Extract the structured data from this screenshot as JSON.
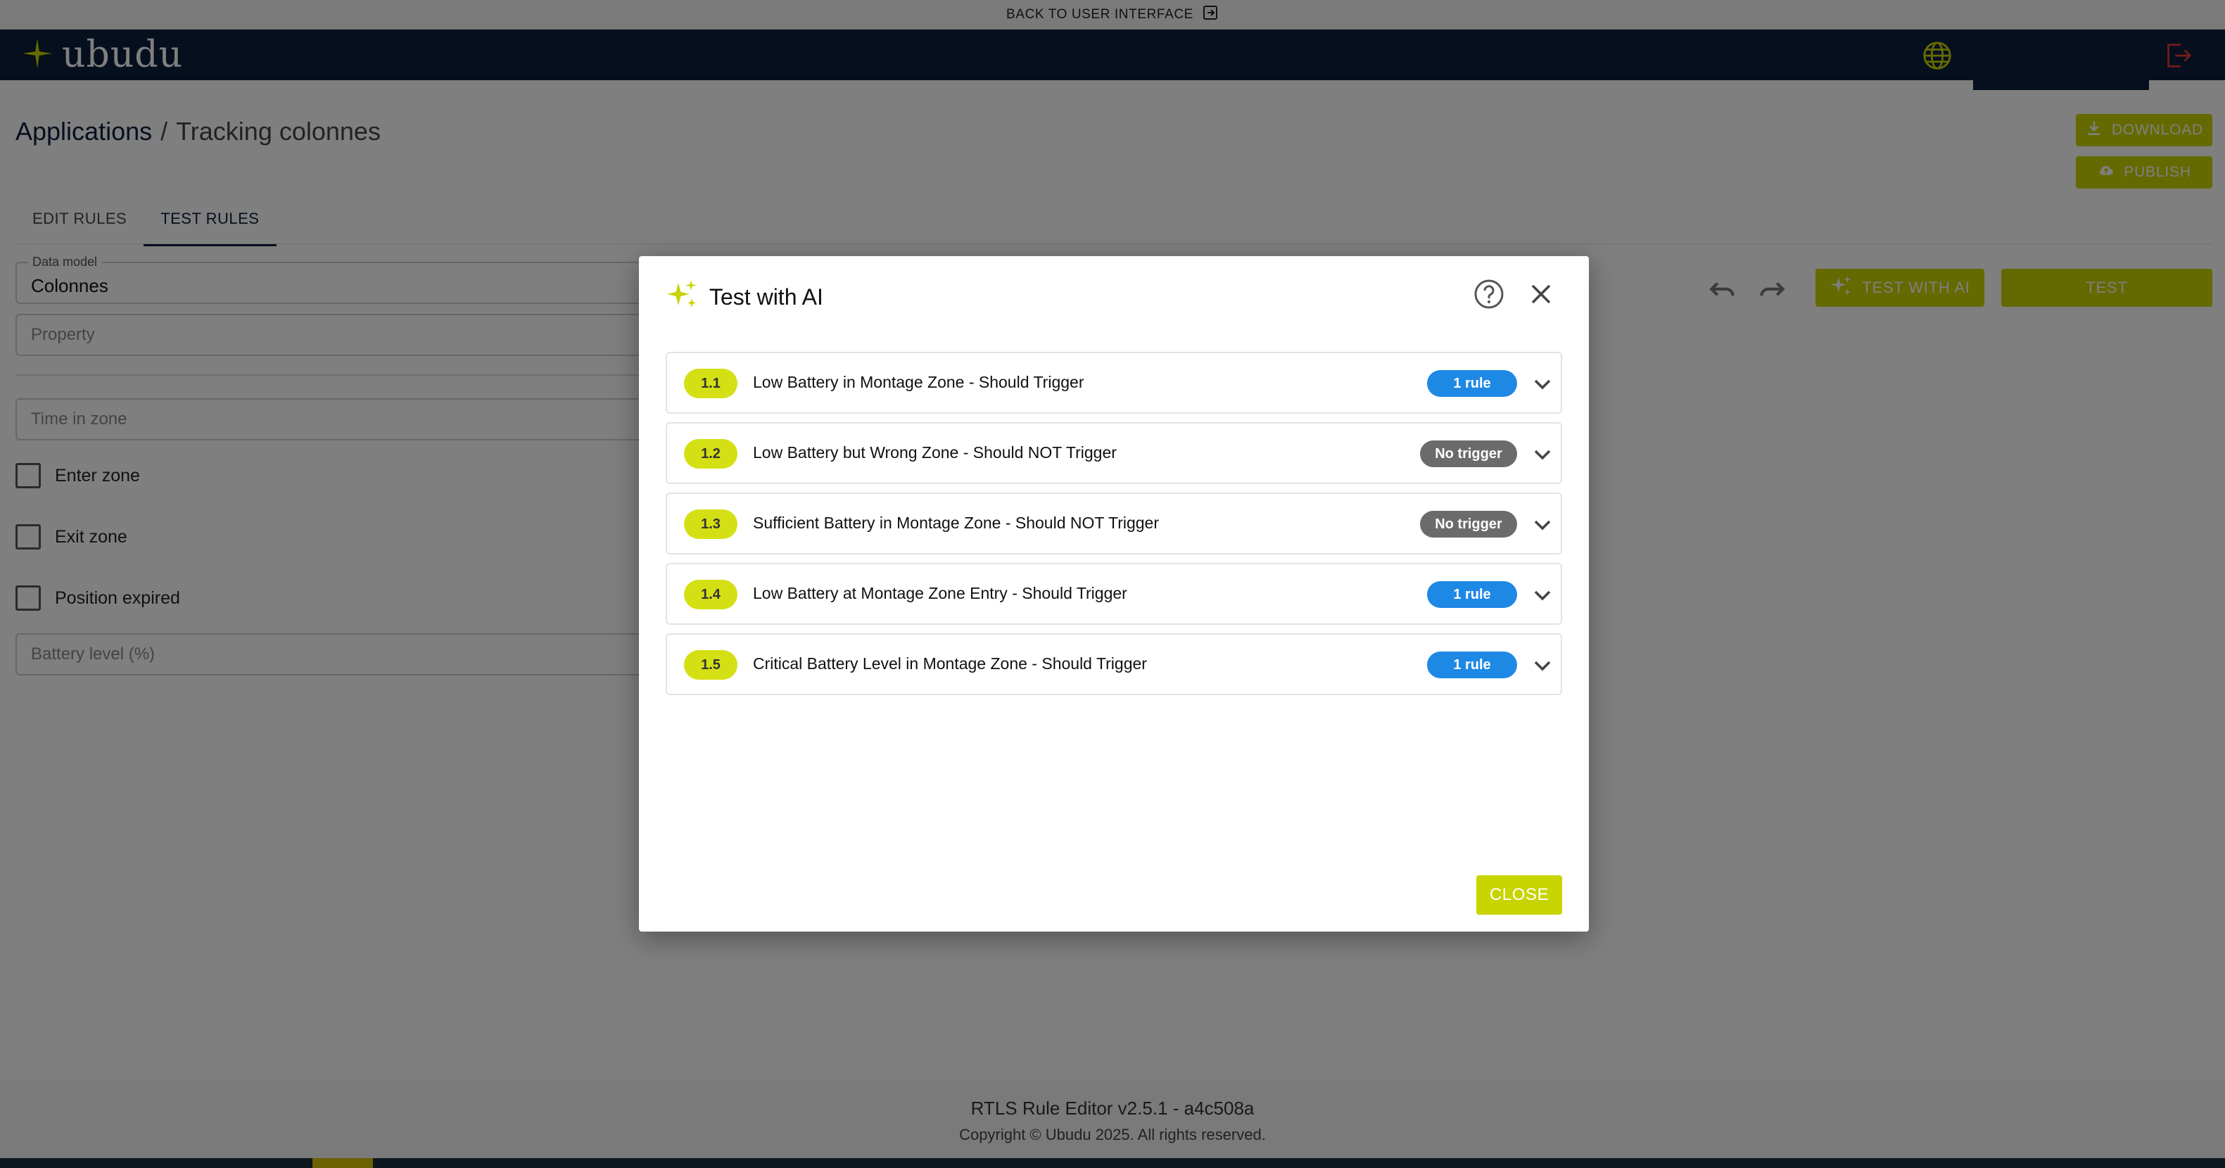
{
  "topstrip": {
    "label": "BACK TO USER INTERFACE"
  },
  "header": {
    "logo_text": "ubudu"
  },
  "breadcrumb": {
    "root": "Applications",
    "separator": "/",
    "current": "Tracking colonnes"
  },
  "tabs": [
    {
      "label": "EDIT RULES",
      "active": false
    },
    {
      "label": "TEST RULES",
      "active": true
    }
  ],
  "actions": {
    "download_label": "DOWNLOAD",
    "publish_label": "PUBLISH"
  },
  "form": {
    "data_model": {
      "legend": "Data model",
      "value": "Colonnes"
    },
    "property": {
      "placeholder": "Property"
    },
    "time_in_zone": {
      "placeholder": "Time in zone"
    },
    "enter_zone": {
      "label": "Enter zone"
    },
    "exit_zone": {
      "label": "Exit zone"
    },
    "position_expired": {
      "label": "Position expired"
    },
    "battery_level": {
      "placeholder": "Battery level (%)"
    }
  },
  "toolbar": {
    "test_with_ai_label": "TEST WITH AI",
    "test_label": "TEST"
  },
  "footer": {
    "version": "RTLS Rule Editor v2.5.1 - a4c508a",
    "copyright": "Copyright © Ubudu 2025. All rights reserved."
  },
  "dialog": {
    "title": "Test with AI",
    "close_label": "CLOSE",
    "scenarios": [
      {
        "id": "1.1",
        "title": "Low Battery in Montage Zone - Should Trigger",
        "status": "1 rule",
        "kind": "rule"
      },
      {
        "id": "1.2",
        "title": "Low Battery but Wrong Zone - Should NOT Trigger",
        "status": "No trigger",
        "kind": "none"
      },
      {
        "id": "1.3",
        "title": "Sufficient Battery in Montage Zone - Should NOT Trigger",
        "status": "No trigger",
        "kind": "none"
      },
      {
        "id": "1.4",
        "title": "Low Battery at Montage Zone Entry - Should Trigger",
        "status": "1 rule",
        "kind": "rule"
      },
      {
        "id": "1.5",
        "title": "Critical Battery Level in Montage Zone - Should Trigger",
        "status": "1 rule",
        "kind": "rule"
      }
    ]
  },
  "colors": {
    "accent": "#c8d400",
    "navy": "#0b1e3a",
    "badge_blue": "#1e88e5",
    "badge_grey": "#6b6b6b",
    "logout_red": "#e53935"
  },
  "icons": [
    "exit-to-app-icon",
    "sparkle-logo-icon",
    "globe-icon",
    "logout-icon",
    "download-icon",
    "cloud-upload-icon",
    "undo-icon",
    "redo-icon",
    "sparkles-icon",
    "help-circle-icon",
    "close-icon",
    "chevron-down-icon"
  ]
}
